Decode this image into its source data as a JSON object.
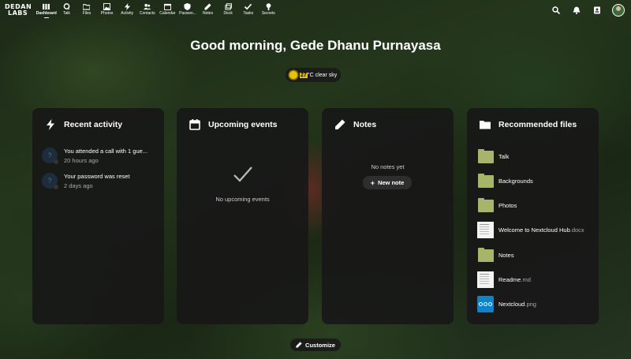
{
  "logo": {
    "line1": "DEDAN",
    "line2": "LABS"
  },
  "nav": {
    "apps": [
      {
        "label": "Dashboard",
        "icon": "dashboard-icon",
        "active": true
      },
      {
        "label": "Talk",
        "icon": "talk-icon"
      },
      {
        "label": "Files",
        "icon": "folder-icon"
      },
      {
        "label": "Photos",
        "icon": "photos-icon"
      },
      {
        "label": "Activity",
        "icon": "activity-icon"
      },
      {
        "label": "Contacts",
        "icon": "contacts-icon"
      },
      {
        "label": "Calendar",
        "icon": "calendar-icon"
      },
      {
        "label": "Passwo...",
        "icon": "passwords-icon"
      },
      {
        "label": "Notes",
        "icon": "notes-icon"
      },
      {
        "label": "Deck",
        "icon": "deck-icon"
      },
      {
        "label": "Tasks",
        "icon": "tasks-icon"
      },
      {
        "label": "Secrets",
        "icon": "secrets-icon"
      }
    ]
  },
  "greeting": "Good morning, Gede Dhanu Purnayasa",
  "weather": {
    "temp": "27",
    "desc": "°C clear sky"
  },
  "panels": {
    "activity": {
      "title": "Recent activity",
      "items": [
        {
          "text": "You attended a call with 1 gue...",
          "time": "20 hours ago"
        },
        {
          "text": "Your password was reset",
          "time": "2 days ago"
        }
      ]
    },
    "events": {
      "title": "Upcoming events",
      "empty": "No upcoming events"
    },
    "notes": {
      "title": "Notes",
      "empty": "No notes yet",
      "new_label": "New note"
    },
    "files": {
      "title": "Recommended files",
      "items": [
        {
          "name": "Talk",
          "type": "folder"
        },
        {
          "name": "Backgrounds",
          "type": "folder"
        },
        {
          "name": "Photos",
          "type": "folder"
        },
        {
          "name": "Welcome to Nextcloud Hub",
          "ext": ".docx",
          "type": "doc"
        },
        {
          "name": "Notes",
          "type": "folder"
        },
        {
          "name": "Readme",
          "ext": ".md",
          "type": "doc"
        },
        {
          "name": "Nextcloud",
          "ext": ".png",
          "type": "png"
        }
      ]
    }
  },
  "customize_label": "Customize"
}
